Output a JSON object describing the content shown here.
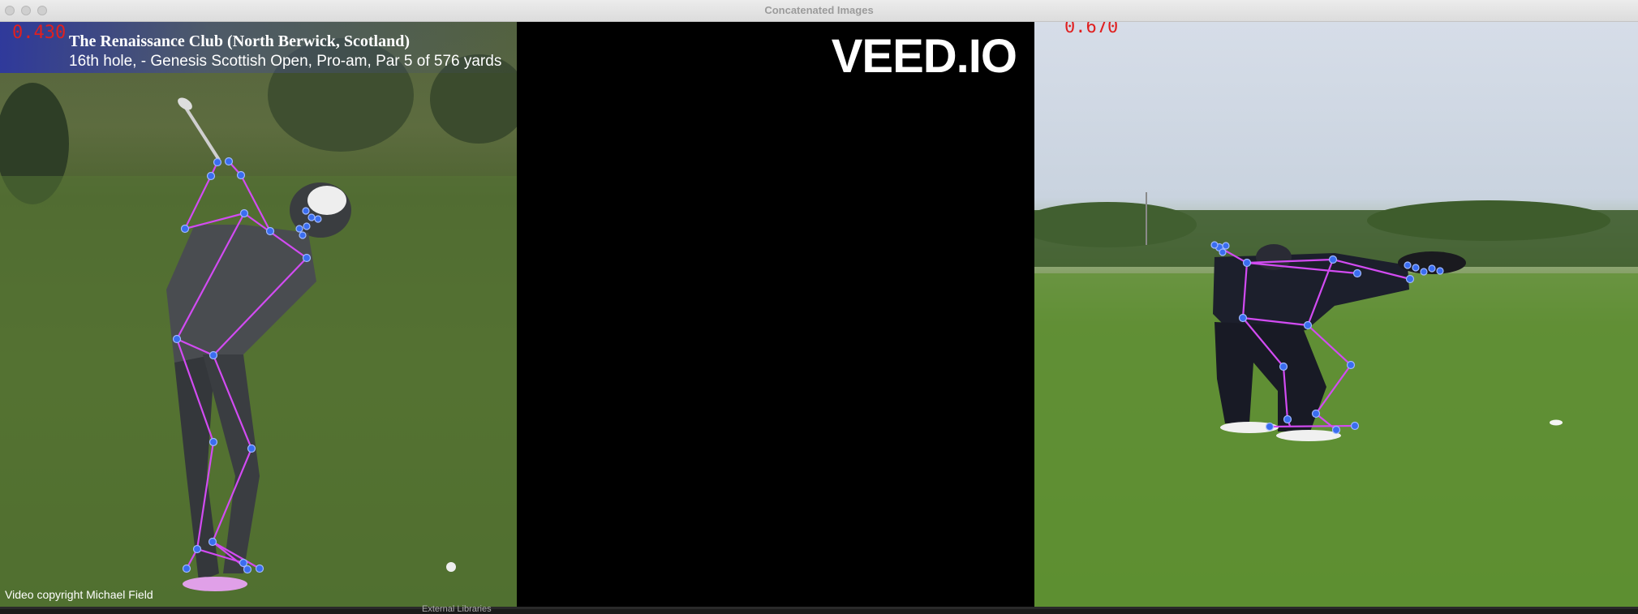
{
  "window": {
    "title": "Concatenated Images"
  },
  "left_panel": {
    "score": "0.430",
    "course_name": "The Renaissance Club (North Berwick, Scotland)",
    "course_detail": "16th hole, - Genesis Scottish Open, Pro-am, Par 5 of 576 yards",
    "copyright": "Video copyright Michael Field"
  },
  "middle_panel": {
    "brand": "VEED.IO"
  },
  "right_panel": {
    "score": "0.670"
  },
  "footer": {
    "text": "External Libraries"
  },
  "colors": {
    "skeleton_line": "#d24bf2",
    "keypoint": "#3a6df0",
    "score_text": "#e02020"
  }
}
